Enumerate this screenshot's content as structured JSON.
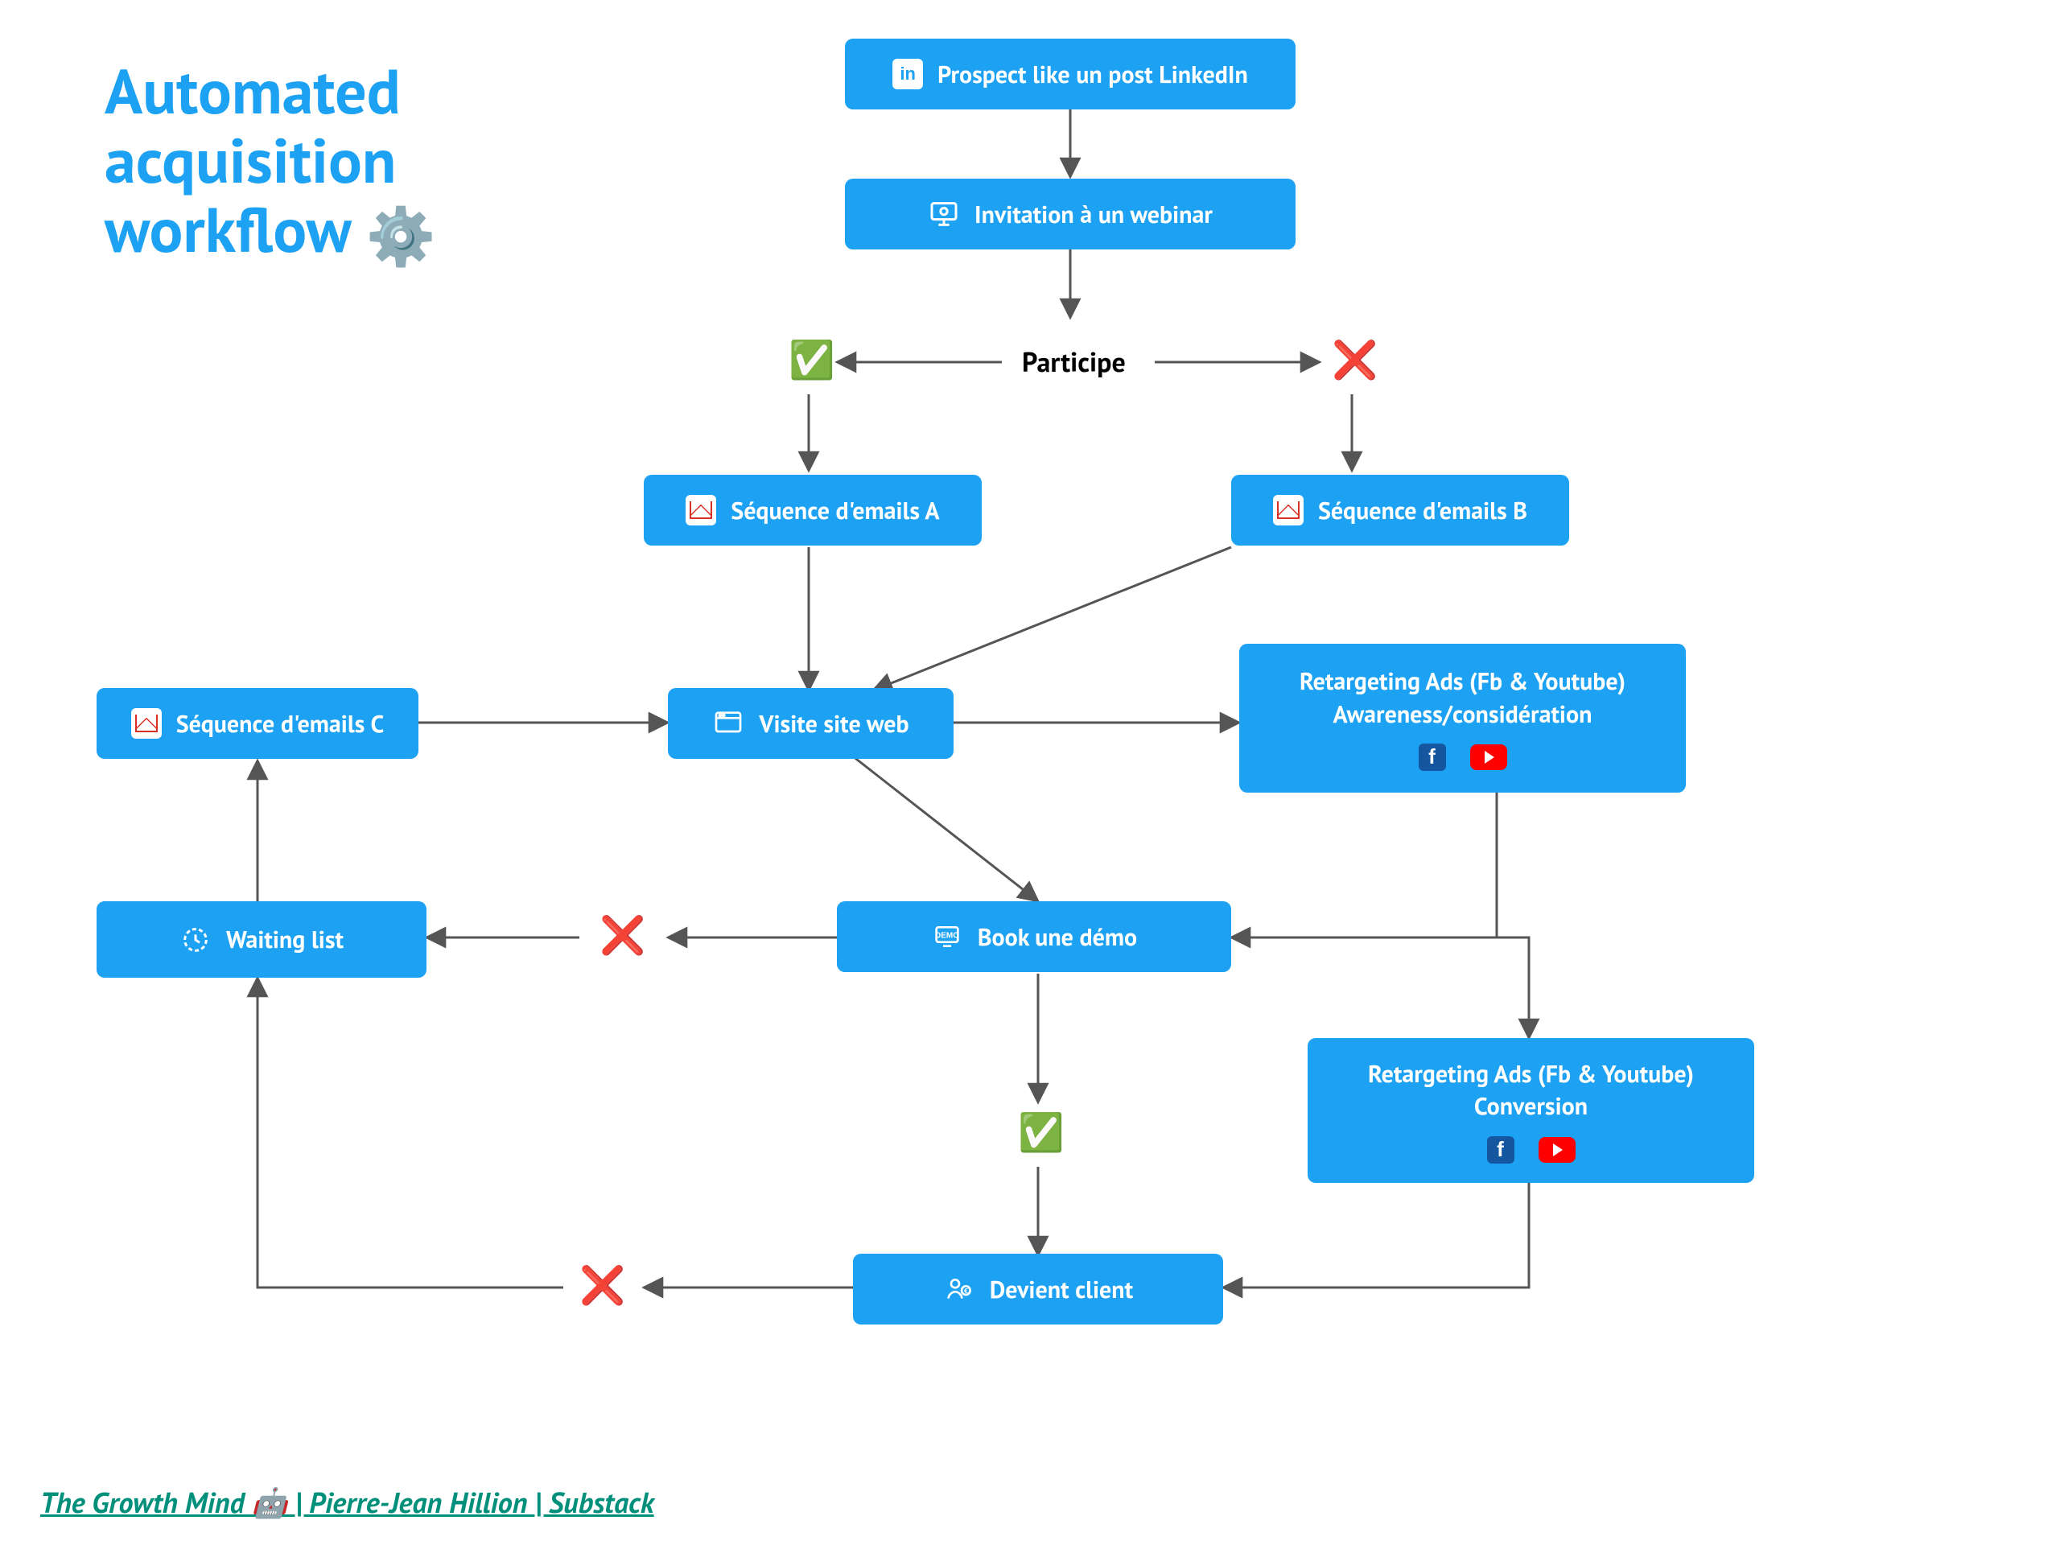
{
  "title_line1": "Automated",
  "title_line2": "acquisition",
  "title_line3": "workflow",
  "footer": "The Growth Mind 🤖 | Pierre-Jean Hillion | Substack",
  "decision_participe": "Participe",
  "nodes": {
    "linkedin": "Prospect like un post LinkedIn",
    "webinar": "Invitation à un webinar",
    "emails_a": "Séquence d'emails A",
    "emails_b": "Séquence d'emails B",
    "emails_c": "Séquence d'emails C",
    "visite": "Visite site web",
    "retarget1_l1": "Retargeting Ads (Fb & Youtube)",
    "retarget1_l2": "Awareness/considération",
    "book": "Book une démo",
    "waiting": "Waiting list",
    "retarget2_l1": "Retargeting Ads (Fb & Youtube)",
    "retarget2_l2": "Conversion",
    "client": "Devient  client"
  },
  "marks": {
    "check": "✅",
    "cross": "❌"
  },
  "colors": {
    "node": "#1da1f2",
    "title": "#1da1f2",
    "footer": "#008f7a",
    "arrow": "#555555"
  }
}
